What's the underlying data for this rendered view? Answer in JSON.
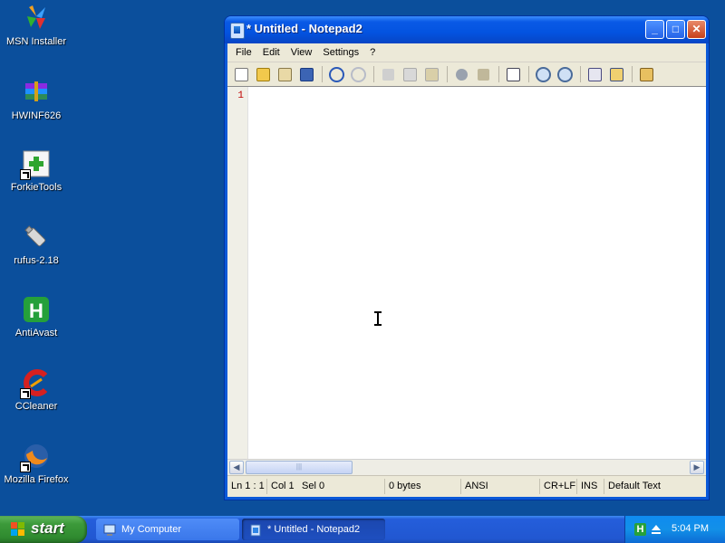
{
  "desktop": {
    "icons": [
      {
        "label": "MSN Installer",
        "icon": "msn-butterfly-icon"
      },
      {
        "label": "HWINF626",
        "icon": "winrar-archive-icon"
      },
      {
        "label": "ForkieTools",
        "icon": "forkietools-icon"
      },
      {
        "label": "rufus-2.18",
        "icon": "usb-drive-icon"
      },
      {
        "label": "AntiAvast",
        "icon": "antiavast-h-icon"
      },
      {
        "label": "CCleaner",
        "icon": "ccleaner-icon"
      },
      {
        "label": "Mozilla Firefox",
        "icon": "firefox-icon"
      }
    ]
  },
  "window": {
    "title": "* Untitled - Notepad2",
    "menu": [
      "File",
      "Edit",
      "View",
      "Settings",
      "?"
    ],
    "toolbar_icons": [
      "new-file-icon",
      "open-folder-icon",
      "browse-icon",
      "save-icon",
      "undo-icon",
      "redo-icon",
      "cut-icon",
      "copy-icon",
      "paste-icon",
      "find-icon",
      "replace-icon",
      "word-wrap-icon",
      "zoom-in-icon",
      "zoom-out-icon",
      "scheme-icon",
      "customize-icon",
      "exit-icon"
    ],
    "gutter_line": "1",
    "statusbar": {
      "position": "Ln 1 : 1",
      "col": "Col 1",
      "sel": "Sel 0",
      "size": "0 bytes",
      "encoding": "ANSI",
      "line_endings": "CR+LF",
      "mode": "INS",
      "scheme": "Default Text"
    }
  },
  "taskbar": {
    "start_label": "start",
    "tasks": [
      {
        "label": "My Computer",
        "active": false
      },
      {
        "label": "* Untitled - Notepad2",
        "active": true
      }
    ],
    "clock": "5:04 PM",
    "tray_h_glyph": "H"
  },
  "colors": {
    "desktop": "#0b4f9c",
    "titlebar": "#0353e0",
    "start": "#3c9a3a",
    "line_number": "#c00000"
  }
}
